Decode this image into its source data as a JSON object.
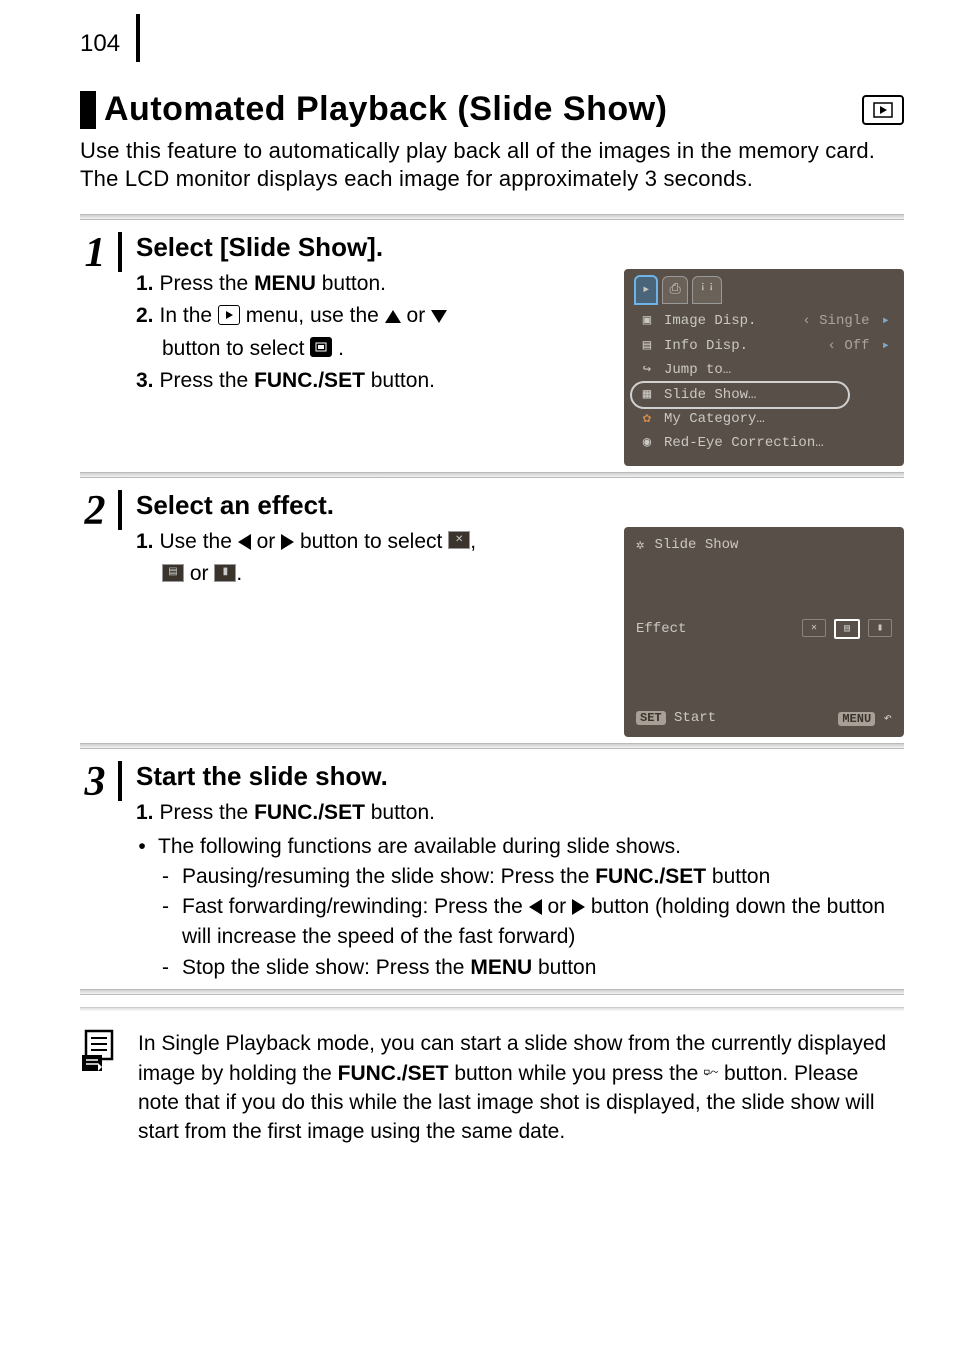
{
  "page_number": "104",
  "title": "Automated Playback (Slide Show)",
  "intro": "Use this feature to automatically play back all of the images in the memory card. The LCD monitor displays each image for approximately 3 seconds.",
  "steps": [
    {
      "num": "1",
      "heading": "Select [Slide Show].",
      "lines": {
        "l1_pre": "1.",
        "l1_a": "Press the ",
        "l1_bold": "MENU",
        "l1_b": " button.",
        "l2_pre": "2.",
        "l2_a": "In the ",
        "l2_b": " menu, use the ",
        "l2_c": " or ",
        "l2_d": "button to select ",
        "l2_e": ".",
        "l3_pre": "3.",
        "l3_a": "Press the ",
        "l3_bold": "FUNC./SET",
        "l3_b": " button."
      },
      "lcd": {
        "items": [
          {
            "label": "Image Disp.",
            "value": "Single"
          },
          {
            "label": "Info Disp.",
            "value": "Off"
          },
          {
            "label": "Jump to…",
            "value": ""
          },
          {
            "label": "Slide Show…",
            "value": "",
            "sel": true
          },
          {
            "label": "My Category…",
            "value": ""
          },
          {
            "label": "Red-Eye Correction…",
            "value": ""
          }
        ]
      }
    },
    {
      "num": "2",
      "heading": "Select an effect.",
      "lines": {
        "l1_pre": "1.",
        "l1_a": "Use the ",
        "l1_b": " or ",
        "l1_c": " button to select ",
        "l1_d": ",",
        "l2_a": " or ",
        "l2_b": "."
      },
      "lcd": {
        "title": "Slide Show",
        "effect_label": "Effect",
        "set_label": "SET",
        "start_label": "Start",
        "menu_label": "MENU"
      }
    },
    {
      "num": "3",
      "heading": "Start the slide show.",
      "lines": {
        "l1_pre": "1.",
        "l1_a": "Press the ",
        "l1_bold": "FUNC./SET",
        "l1_b": " button."
      },
      "bullet": "The following functions are available during slide shows.",
      "dashes": {
        "d1_a": "Pausing/resuming the slide show: Press the ",
        "d1_bold": "FUNC./SET",
        "d1_b": " button",
        "d2_a": "Fast forwarding/rewinding: Press the ",
        "d2_b": " or ",
        "d2_c": " button (holding down the button will increase the speed of the fast forward)",
        "d3_a": "Stop the slide show: Press the ",
        "d3_bold": "MENU",
        "d3_b": " button"
      }
    }
  ],
  "note": {
    "a": "In Single Playback mode, you can start a slide show from the currently displayed image by holding the ",
    "bold1": "FUNC./SET",
    "b": " button while you press the ",
    "c": " button. Please note that if you do this while the last image shot is displayed, the slide show will start from the first image using the same date."
  }
}
